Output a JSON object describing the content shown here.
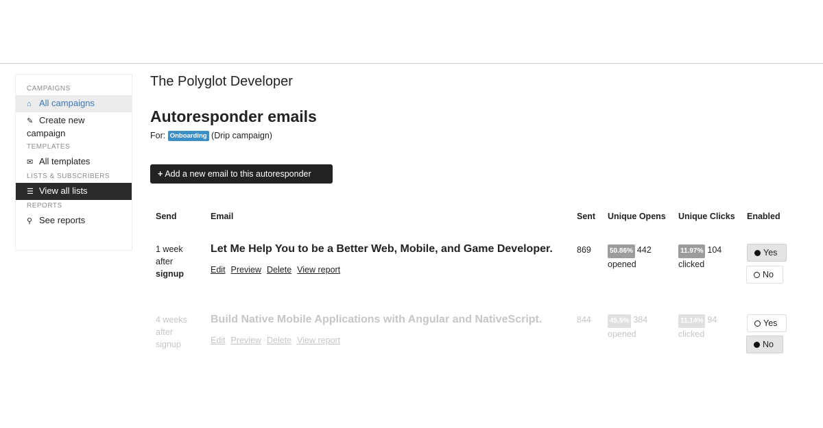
{
  "sidebar": {
    "campaigns_head": "CAMPAIGNS",
    "all_campaigns": "All campaigns",
    "create_new_line1": "Create new",
    "create_new_line2": "campaign",
    "templates_head": "TEMPLATES",
    "all_templates": "All templates",
    "lists_head": "LISTS & SUBSCRIBERS",
    "view_all_lists": "View all lists",
    "reports_head": "REPORTS",
    "see_reports": "See reports"
  },
  "site_title": "The Polyglot Developer",
  "heading": "Autoresponder emails",
  "for_label": "For:",
  "campaign_tag": "Onboarding",
  "campaign_type": "(Drip campaign)",
  "add_button": "Add a new email to this autoresponder",
  "table": {
    "headers": {
      "send": "Send",
      "email": "Email",
      "sent": "Sent",
      "opens": "Unique Opens",
      "clicks": "Unique Clicks",
      "enabled": "Enabled"
    },
    "rows": [
      {
        "send_1": "1 week",
        "send_2": "after",
        "send_3": "signup",
        "subject": "Let Me Help You to be a Better Web, Mobile, and Game Developer.",
        "edit": "Edit",
        "preview": "Preview",
        "delete": "Delete",
        "view_report": "View report",
        "sent": "869",
        "opens_pct": "50.86%",
        "opens_count": "442",
        "opens_label": "opened",
        "clicks_pct": "11.97%",
        "clicks_count": "104",
        "clicks_label": "clicked",
        "yes": "Yes",
        "no": "No"
      },
      {
        "send_1": "4 weeks",
        "send_2": "after",
        "send_3": "signup",
        "subject": "Build Native Mobile Applications with Angular and NativeScript.",
        "edit": "Edit",
        "preview": "Preview",
        "delete": "Delete",
        "view_report": "View report",
        "sent": "844",
        "opens_pct": "45.5%",
        "opens_count": "384",
        "opens_label": "opened",
        "clicks_pct": "11.14%",
        "clicks_count": "94",
        "clicks_label": "clicked",
        "yes": "Yes",
        "no": "No"
      }
    ]
  },
  "colors": {
    "accent": "#3a8fc9",
    "link_active": "#3a78b8",
    "dark": "#2b2b2b"
  }
}
